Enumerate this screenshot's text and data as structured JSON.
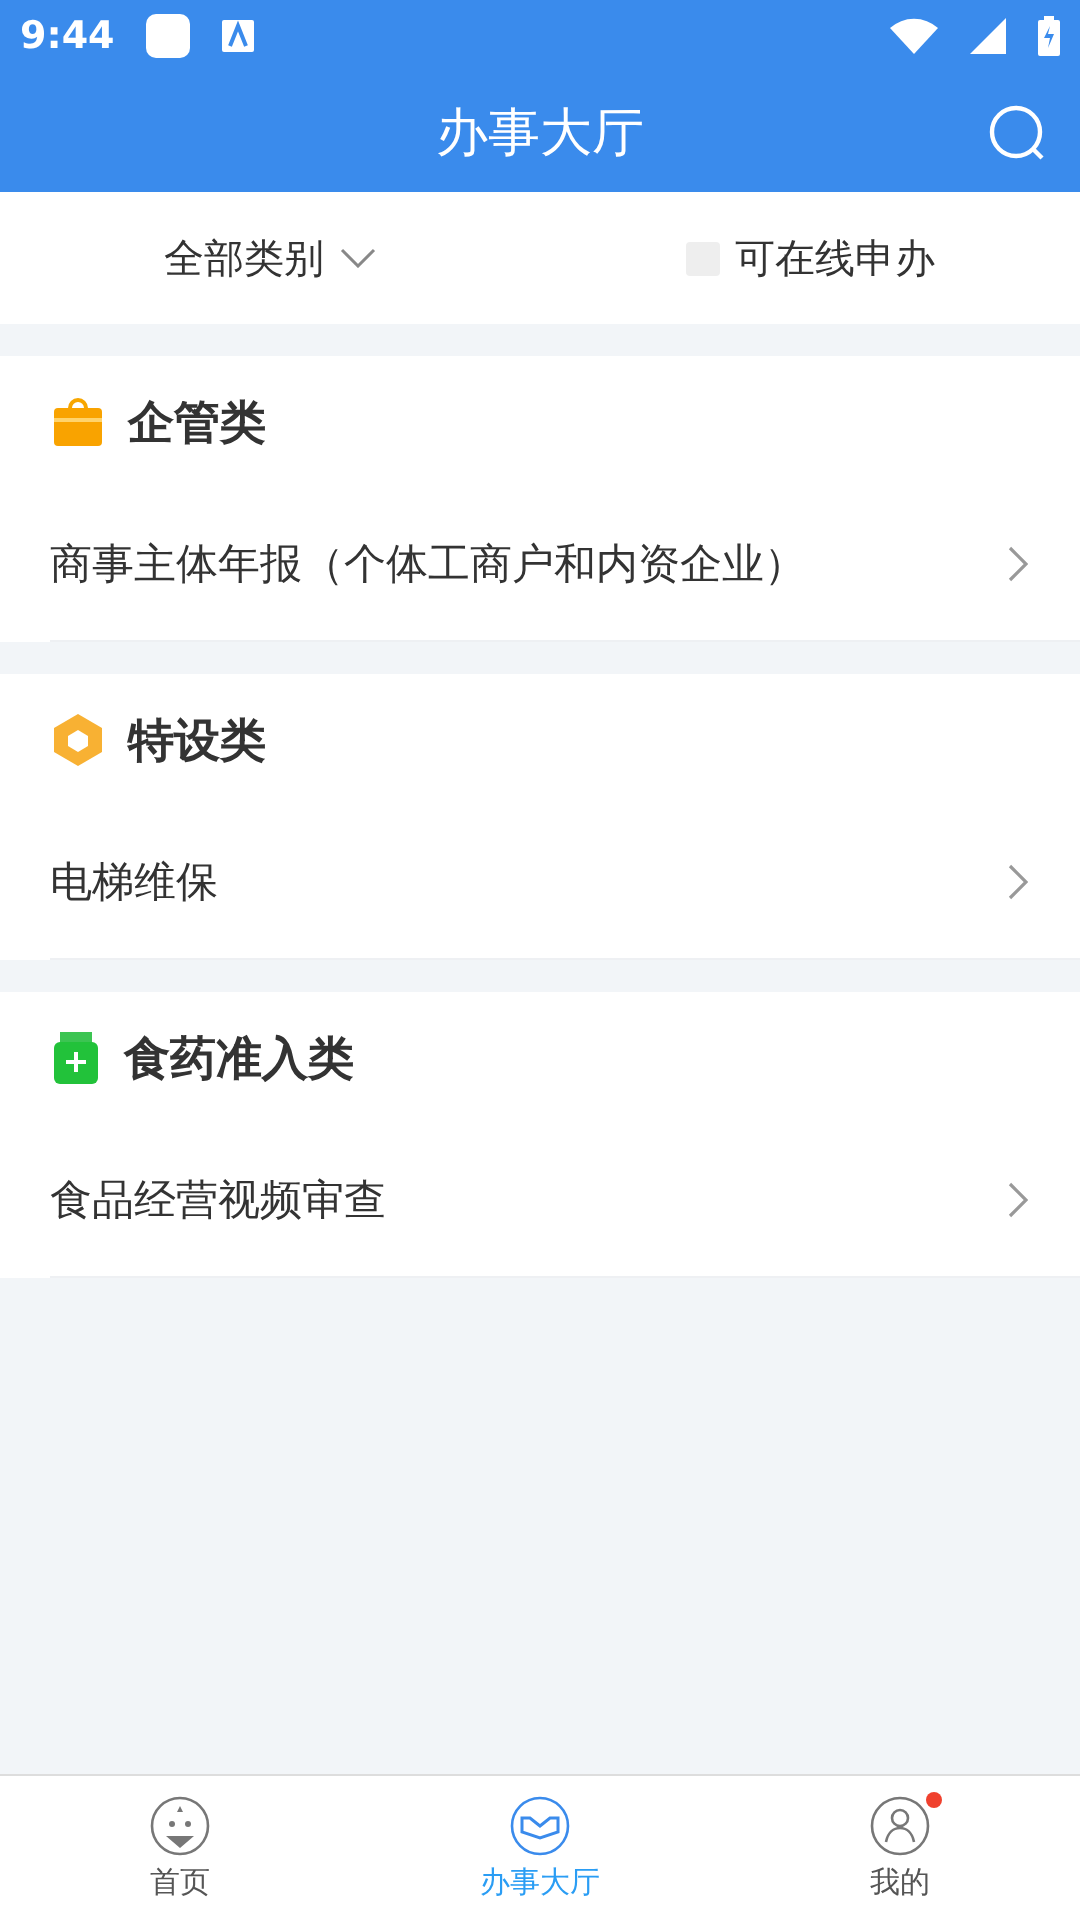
{
  "status_bar": {
    "time": "9:44"
  },
  "header": {
    "title": "办事大厅"
  },
  "filter": {
    "category": "全部类别",
    "online": {
      "label": "可在线申办",
      "checked": false
    }
  },
  "sections": [
    {
      "title": "企管类",
      "kind": "briefcase",
      "items": [
        "商事主体年报（个体工商户和内资企业）"
      ]
    },
    {
      "title": "特设类",
      "kind": "hexagon",
      "items": [
        "电梯维保"
      ]
    },
    {
      "title": "食药准入类",
      "kind": "bottle",
      "items": [
        "食品经营视频审查"
      ]
    }
  ],
  "tabs": [
    {
      "label": "首页",
      "kind": "home",
      "selected": false,
      "badge": false
    },
    {
      "label": "办事大厅",
      "kind": "hall",
      "selected": true,
      "badge": false
    },
    {
      "label": "我的",
      "kind": "me",
      "selected": false,
      "badge": true
    }
  ]
}
